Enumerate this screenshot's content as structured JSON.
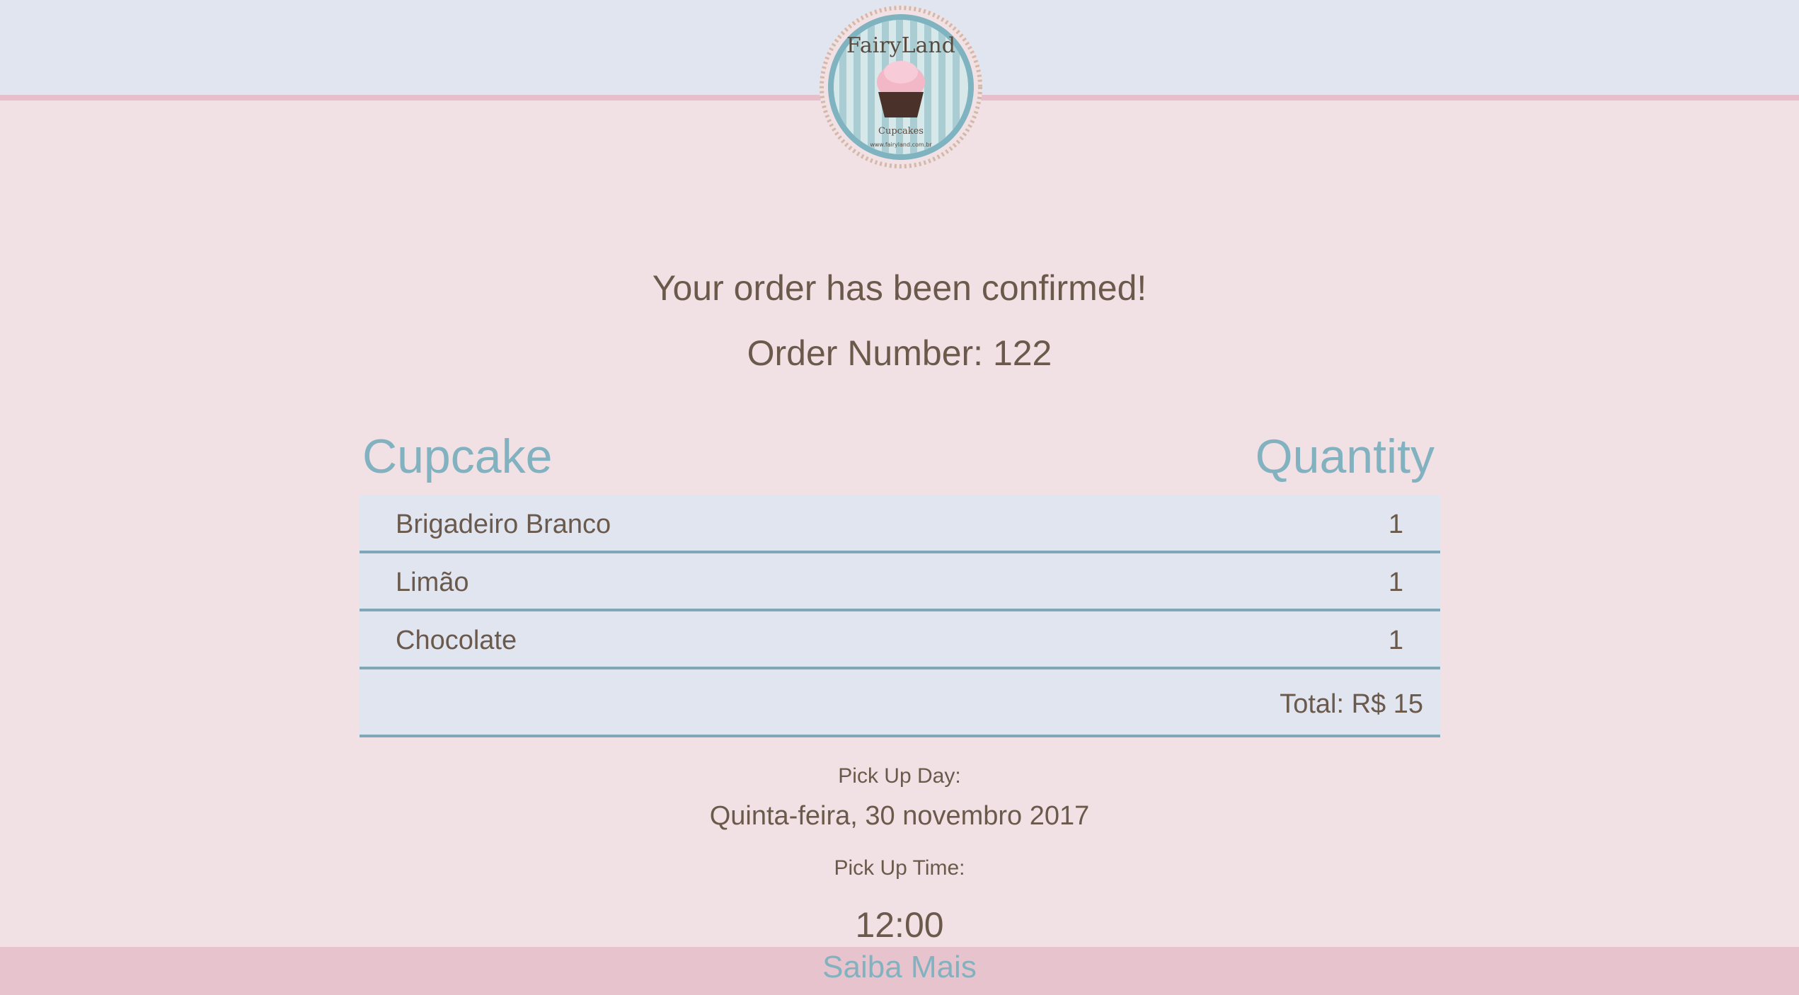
{
  "brand": {
    "logo_name": "FairyLand",
    "logo_sub": "Cupcakes",
    "logo_url": "www.fairyland.com.br"
  },
  "confirmation": {
    "title": "Your order has been confirmed!",
    "order_number": "Order Number: 122"
  },
  "table": {
    "col_item": "Cupcake",
    "col_qty": "Quantity",
    "rows": [
      {
        "name": "Brigadeiro Branco",
        "qty": "1"
      },
      {
        "name": "Limão",
        "qty": "1"
      },
      {
        "name": "Chocolate",
        "qty": "1"
      }
    ],
    "total": "Total: R$ 15"
  },
  "pickup": {
    "day_label": "Pick Up Day:",
    "day_value": "Quinta-feira, 30 novembro 2017",
    "time_label": "Pick Up Time:",
    "time_value": "12:00"
  },
  "footer": {
    "link_label": "Saiba Mais"
  },
  "colors": {
    "page_bg": "#f1e1e4",
    "header_bg": "#e0e5f0",
    "accent_blue": "#82b2c0",
    "accent_pink": "#e6bfcb",
    "text_brown": "#6b5a4c"
  }
}
